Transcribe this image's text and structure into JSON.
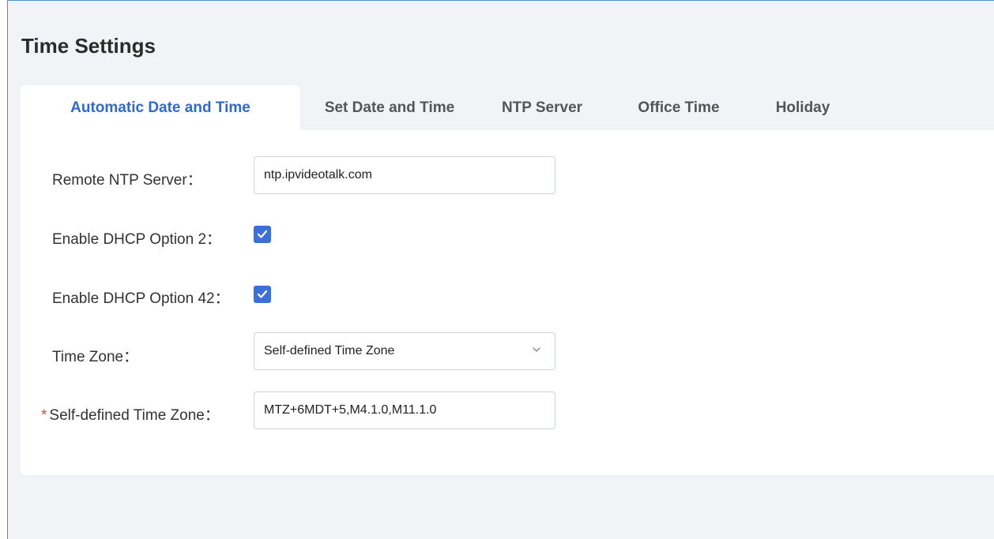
{
  "page": {
    "title": "Time Settings"
  },
  "tabs": [
    {
      "label": "Automatic Date and Time",
      "active": true
    },
    {
      "label": "Set Date and Time",
      "active": false
    },
    {
      "label": "NTP Server",
      "active": false
    },
    {
      "label": "Office Time",
      "active": false
    },
    {
      "label": "Holiday",
      "active": false
    }
  ],
  "form": {
    "remote_ntp": {
      "label": "Remote NTP Server：",
      "value": "ntp.ipvideotalk.com"
    },
    "dhcp_option2": {
      "label": "Enable DHCP Option 2：",
      "checked": true
    },
    "dhcp_option42": {
      "label": "Enable DHCP Option 42：",
      "checked": true
    },
    "time_zone": {
      "label": "Time Zone：",
      "selected": "Self-defined Time Zone"
    },
    "self_defined_tz": {
      "required_mark": "*",
      "label": "Self-defined Time Zone：",
      "value": "MTZ+6MDT+5,M4.1.0,M11.1.0"
    }
  },
  "colors": {
    "accent": "#2e6bc6",
    "checkbox": "#3d6fd8",
    "required": "#e04343",
    "frame_border": "#4a90d9"
  },
  "icons": {
    "checkbox": "check-icon",
    "dropdown": "chevron-down-icon"
  }
}
